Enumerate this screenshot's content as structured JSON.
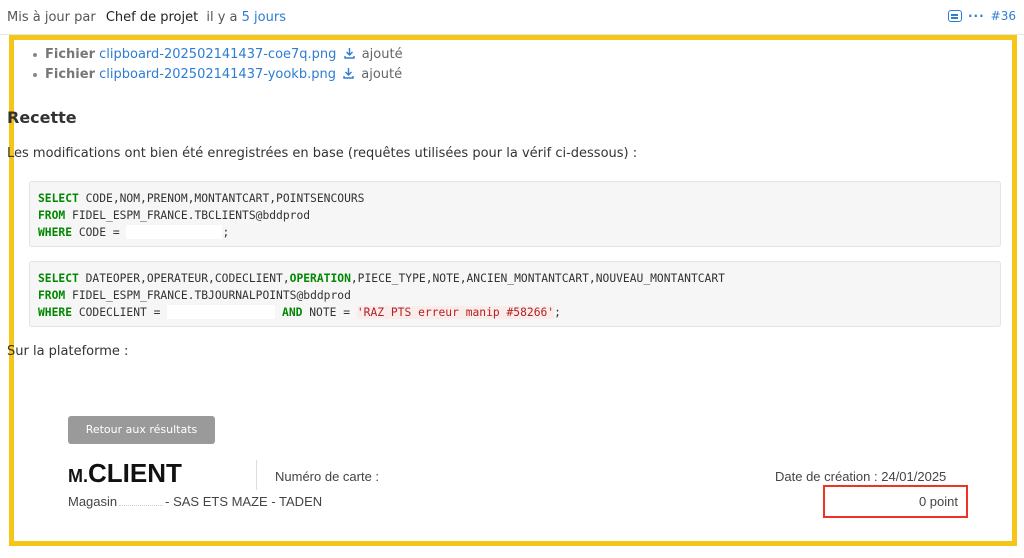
{
  "header": {
    "prefix": "Mis à jour par",
    "author": "Chef de projet",
    "ago_prefix": "il y a",
    "ago_link": "5 jours",
    "number": "#36"
  },
  "attachments": [
    {
      "kind": "Fichier",
      "file": "clipboard-202502141437-coe7q.png",
      "status": "ajouté"
    },
    {
      "kind": "Fichier",
      "file": "clipboard-202502141437-yookb.png",
      "status": "ajouté"
    }
  ],
  "section_title": "Recette",
  "paragraph": "Les modifications ont bien été enregistrées en base (requêtes utilisées pour la vérif ci-dessous) :",
  "code1": {
    "kw_select": "SELECT",
    "select_cols": " CODE,NOM,PRENOM,MONTANTCART,POINTSENCOURS",
    "kw_from": "FROM",
    "from_table": " FIDEL_ESPM_FRANCE.TBCLIENTS@bddprod",
    "kw_where": "WHERE",
    "where_col": " CODE = ",
    "where_end": ";"
  },
  "code2": {
    "kw_select": "SELECT",
    "select_cols_a": " DATEOPER,OPERATEUR,CODECLIENT,",
    "kw_operation": "OPERATION",
    "select_cols_b": ",PIECE_TYPE,NOTE,ANCIEN_MONTANTCART,NOUVEAU_MONTANTCART",
    "kw_from": "FROM",
    "from_table": " FIDEL_ESPM_FRANCE.TBJOURNALPOINTS@bddprod",
    "kw_where": "WHERE",
    "where_col": " CODECLIENT = ",
    "kw_and": "AND",
    "note_part": " NOTE = ",
    "string": "'RAZ PTS erreur manip #58266'",
    "end": ";"
  },
  "paragraph2": "Sur la plateforme :",
  "platform": {
    "back_button": "Retour aux résultats",
    "title_m": "M.",
    "title_client": "CLIENT",
    "card_label": "Numéro de carte :",
    "date_label": "Date de création : 24/01/2025",
    "store_prefix": "Magasin",
    "store_suffix": "- SAS ETS MAZE - TADEN",
    "points": "0 point"
  },
  "colors": {
    "highlight_frame": "#f5c518",
    "link": "#2d7dd2",
    "red_box": "#e32"
  }
}
